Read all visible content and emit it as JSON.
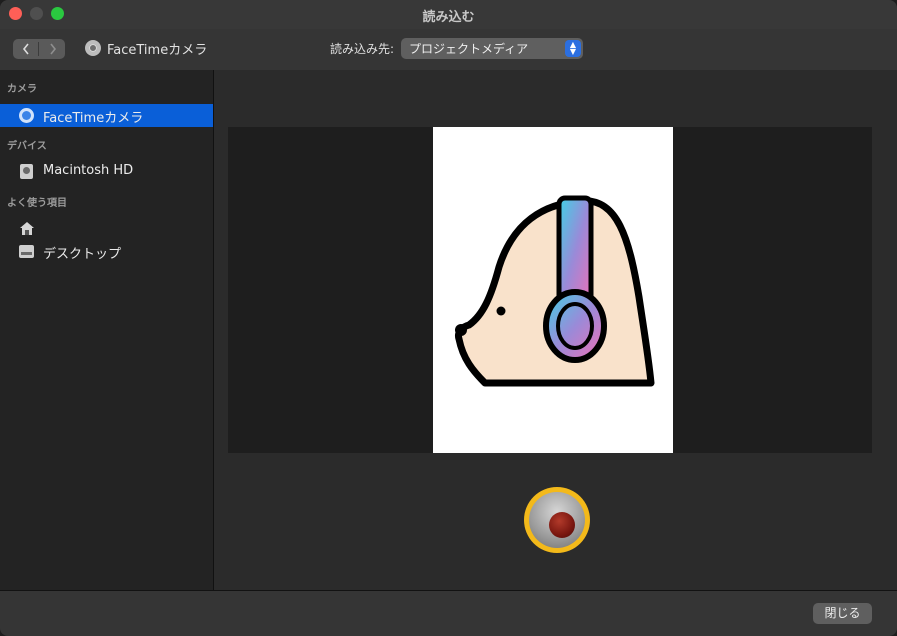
{
  "window": {
    "title": "読み込む"
  },
  "toolbar": {
    "device_name": "FaceTimeカメラ",
    "destination_label": "読み込み先:",
    "destination_value": "プロジェクトメディア"
  },
  "sidebar": {
    "sections": [
      {
        "header": "カメラ",
        "items": [
          {
            "label": "FaceTimeカメラ",
            "icon": "camera-icon",
            "selected": true
          }
        ]
      },
      {
        "header": "デバイス",
        "items": [
          {
            "label": "Macintosh HD",
            "icon": "disk-icon"
          }
        ]
      },
      {
        "header": "よく使う項目",
        "items": [
          {
            "label": "",
            "icon": "home-icon"
          },
          {
            "label": "デスクトップ",
            "icon": "desktop-icon"
          }
        ]
      }
    ]
  },
  "footer": {
    "close_label": "閉じる"
  },
  "colors": {
    "selection": "#0a5fd8",
    "record_ring": "#f3b91a",
    "record_dot": "#7a1710"
  }
}
